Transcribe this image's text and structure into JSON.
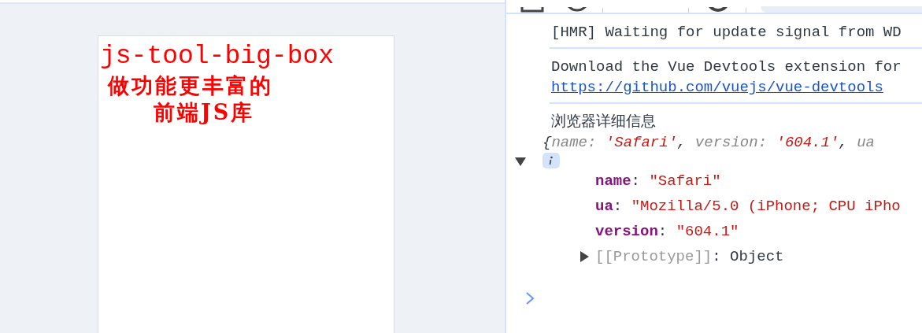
{
  "preview": {
    "title": "js-tool-big-box",
    "subtitle_lines": [
      "做功能更丰富的",
      "前端JS库"
    ]
  },
  "console": {
    "messages": [
      {
        "kind": "log",
        "text": "[HMR] Waiting for update signal from WD"
      },
      {
        "kind": "log-link",
        "text": "Download the Vue Devtools extension for",
        "link": "https://github.com/vuejs/vue-devtools"
      },
      {
        "kind": "object",
        "label": "浏览器详细信息",
        "expanded": true,
        "summary": [
          {
            "kind": "punct",
            "text": "{"
          },
          {
            "kind": "key",
            "text": "name: "
          },
          {
            "kind": "string",
            "text": "'Safari'"
          },
          {
            "kind": "punct",
            "text": ", "
          },
          {
            "kind": "key",
            "text": "version: "
          },
          {
            "kind": "string",
            "text": "'604.1'"
          },
          {
            "kind": "punct",
            "text": ", "
          },
          {
            "kind": "key",
            "text": "ua"
          }
        ],
        "properties": [
          {
            "key": "name",
            "sep": ": ",
            "value": "\"Safari\""
          },
          {
            "key": "ua",
            "sep": ": ",
            "value": "\"Mozilla/5.0 (iPhone; CPU iPho"
          },
          {
            "key": "version",
            "sep": ": ",
            "value": "\"604.1\""
          }
        ],
        "prototype": {
          "label": "[[Prototype]]",
          "sep": ": ",
          "value": "Object",
          "expanded": false
        }
      }
    ]
  }
}
